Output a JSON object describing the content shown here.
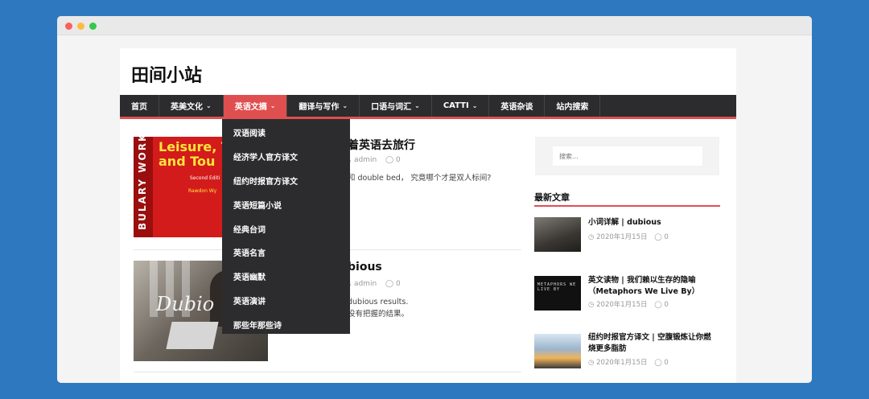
{
  "site": {
    "title": "田间小站"
  },
  "nav": {
    "items": [
      {
        "label": "首页",
        "caret": ""
      },
      {
        "label": "英美文化",
        "caret": "⌄"
      },
      {
        "label": "英语文摘",
        "caret": "⌄"
      },
      {
        "label": "翻译与写作",
        "caret": "⌄"
      },
      {
        "label": "口语与词汇",
        "caret": "⌄"
      },
      {
        "label": "CATTI",
        "caret": "⌄"
      },
      {
        "label": "英语杂谈",
        "caret": ""
      },
      {
        "label": "站内搜索",
        "caret": ""
      }
    ],
    "active_index": 2
  },
  "dropdown": {
    "items": [
      "双语阅读",
      "经济学人官方译文",
      "纽约时报官方译文",
      "英语短篇小说",
      "经典台词",
      "英语名言",
      "英语幽默",
      "英语演讲",
      "那些年那些诗"
    ]
  },
  "posts": [
    {
      "title": "着英语去旅行",
      "author": "admin",
      "comments": "0",
      "excerpt": [
        "和 double bed， 究竟哪个才是双人标间?"
      ],
      "image": {
        "side_text": "BULARY WORK",
        "title_lines": [
          "Leisure, T",
          "and Tou"
        ],
        "edition": "Second Editi",
        "author": "Rawdon Wy"
      }
    },
    {
      "title": "bious",
      "author": "admin",
      "comments": "0",
      "excerpt": [
        "dubious results.",
        "没有把握的结果。"
      ],
      "image": {
        "script_text": "Dubio"
      }
    }
  ],
  "sidebar": {
    "search_placeholder": "搜索...",
    "recent_title": "最新文章",
    "recent": [
      {
        "title_lines": [
          "小词详解 | dubious"
        ],
        "date": "2020年1月15日",
        "comments": "0"
      },
      {
        "title_lines": [
          "英文读物 | 我们赖以生存的隐喻",
          "（Metaphors We Live By）"
        ],
        "date": "2020年1月15日",
        "comments": "0",
        "thumb_text": "METAPHORS WE LIVE BY"
      },
      {
        "title_lines": [
          "纽约时报官方译文 | 空腹锻炼让你燃",
          "烧更多脂肪"
        ],
        "date": "2020年1月15日",
        "comments": "0"
      }
    ]
  },
  "icons": {
    "user": "user-icon",
    "comment": "comment-icon",
    "clock": "clock-icon"
  },
  "colors": {
    "accent": "#e04f4f",
    "nav_bg": "#2c2c2e",
    "background": "#2e78c0"
  }
}
